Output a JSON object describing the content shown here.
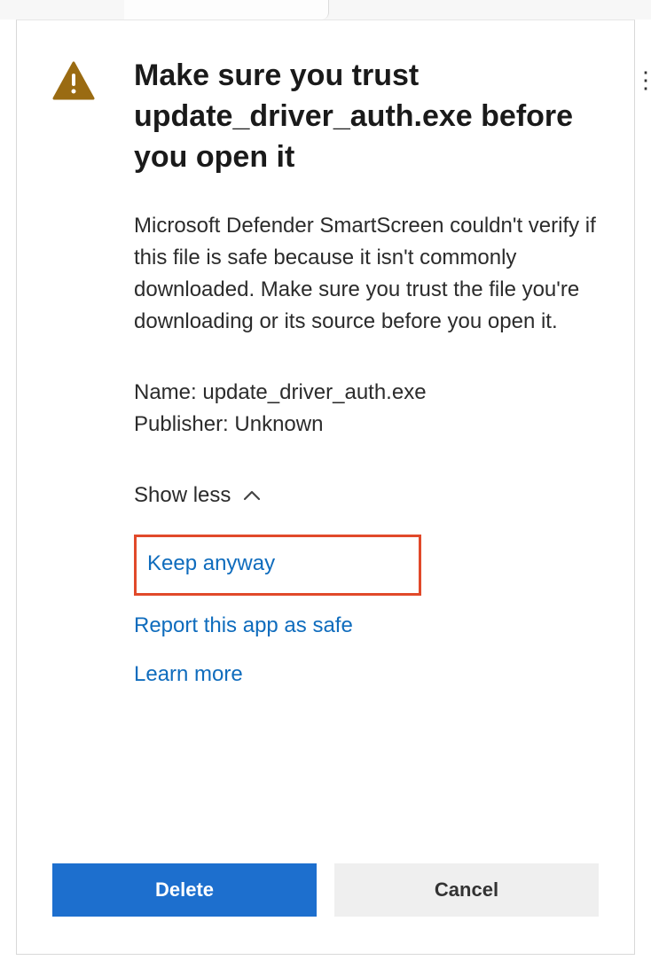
{
  "dialog": {
    "title": "Make sure you trust update_driver_auth.exe before you open it",
    "body": "Microsoft Defender SmartScreen couldn't verify if this file is safe because it isn't commonly downloaded. Make sure you trust the file you're downloading or its source before you open it.",
    "name_label": "Name: ",
    "name_value": "update_driver_auth.exe",
    "publisher_label": "Publisher: ",
    "publisher_value": "Unknown",
    "toggle_label": "Show less",
    "links": {
      "keep_anyway": "Keep anyway",
      "report_safe": "Report this app as safe",
      "learn_more": "Learn more"
    },
    "buttons": {
      "delete": "Delete",
      "cancel": "Cancel"
    }
  }
}
